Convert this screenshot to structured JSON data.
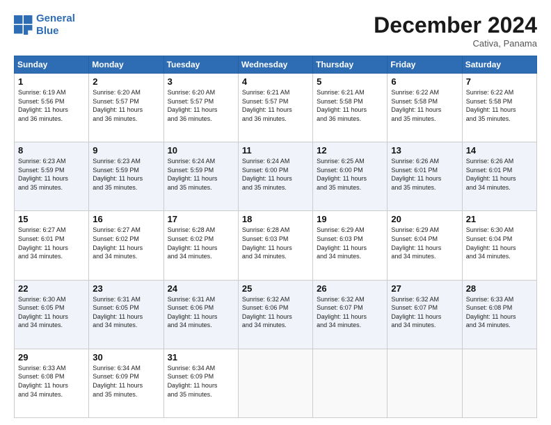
{
  "header": {
    "logo_line1": "General",
    "logo_line2": "Blue",
    "month": "December 2024",
    "location": "Cativa, Panama"
  },
  "days_of_week": [
    "Sunday",
    "Monday",
    "Tuesday",
    "Wednesday",
    "Thursday",
    "Friday",
    "Saturday"
  ],
  "weeks": [
    [
      {
        "day": "1",
        "info": "Sunrise: 6:19 AM\nSunset: 5:56 PM\nDaylight: 11 hours\nand 36 minutes."
      },
      {
        "day": "2",
        "info": "Sunrise: 6:20 AM\nSunset: 5:57 PM\nDaylight: 11 hours\nand 36 minutes."
      },
      {
        "day": "3",
        "info": "Sunrise: 6:20 AM\nSunset: 5:57 PM\nDaylight: 11 hours\nand 36 minutes."
      },
      {
        "day": "4",
        "info": "Sunrise: 6:21 AM\nSunset: 5:57 PM\nDaylight: 11 hours\nand 36 minutes."
      },
      {
        "day": "5",
        "info": "Sunrise: 6:21 AM\nSunset: 5:58 PM\nDaylight: 11 hours\nand 36 minutes."
      },
      {
        "day": "6",
        "info": "Sunrise: 6:22 AM\nSunset: 5:58 PM\nDaylight: 11 hours\nand 35 minutes."
      },
      {
        "day": "7",
        "info": "Sunrise: 6:22 AM\nSunset: 5:58 PM\nDaylight: 11 hours\nand 35 minutes."
      }
    ],
    [
      {
        "day": "8",
        "info": "Sunrise: 6:23 AM\nSunset: 5:59 PM\nDaylight: 11 hours\nand 35 minutes."
      },
      {
        "day": "9",
        "info": "Sunrise: 6:23 AM\nSunset: 5:59 PM\nDaylight: 11 hours\nand 35 minutes."
      },
      {
        "day": "10",
        "info": "Sunrise: 6:24 AM\nSunset: 5:59 PM\nDaylight: 11 hours\nand 35 minutes."
      },
      {
        "day": "11",
        "info": "Sunrise: 6:24 AM\nSunset: 6:00 PM\nDaylight: 11 hours\nand 35 minutes."
      },
      {
        "day": "12",
        "info": "Sunrise: 6:25 AM\nSunset: 6:00 PM\nDaylight: 11 hours\nand 35 minutes."
      },
      {
        "day": "13",
        "info": "Sunrise: 6:26 AM\nSunset: 6:01 PM\nDaylight: 11 hours\nand 35 minutes."
      },
      {
        "day": "14",
        "info": "Sunrise: 6:26 AM\nSunset: 6:01 PM\nDaylight: 11 hours\nand 34 minutes."
      }
    ],
    [
      {
        "day": "15",
        "info": "Sunrise: 6:27 AM\nSunset: 6:01 PM\nDaylight: 11 hours\nand 34 minutes."
      },
      {
        "day": "16",
        "info": "Sunrise: 6:27 AM\nSunset: 6:02 PM\nDaylight: 11 hours\nand 34 minutes."
      },
      {
        "day": "17",
        "info": "Sunrise: 6:28 AM\nSunset: 6:02 PM\nDaylight: 11 hours\nand 34 minutes."
      },
      {
        "day": "18",
        "info": "Sunrise: 6:28 AM\nSunset: 6:03 PM\nDaylight: 11 hours\nand 34 minutes."
      },
      {
        "day": "19",
        "info": "Sunrise: 6:29 AM\nSunset: 6:03 PM\nDaylight: 11 hours\nand 34 minutes."
      },
      {
        "day": "20",
        "info": "Sunrise: 6:29 AM\nSunset: 6:04 PM\nDaylight: 11 hours\nand 34 minutes."
      },
      {
        "day": "21",
        "info": "Sunrise: 6:30 AM\nSunset: 6:04 PM\nDaylight: 11 hours\nand 34 minutes."
      }
    ],
    [
      {
        "day": "22",
        "info": "Sunrise: 6:30 AM\nSunset: 6:05 PM\nDaylight: 11 hours\nand 34 minutes."
      },
      {
        "day": "23",
        "info": "Sunrise: 6:31 AM\nSunset: 6:05 PM\nDaylight: 11 hours\nand 34 minutes."
      },
      {
        "day": "24",
        "info": "Sunrise: 6:31 AM\nSunset: 6:06 PM\nDaylight: 11 hours\nand 34 minutes."
      },
      {
        "day": "25",
        "info": "Sunrise: 6:32 AM\nSunset: 6:06 PM\nDaylight: 11 hours\nand 34 minutes."
      },
      {
        "day": "26",
        "info": "Sunrise: 6:32 AM\nSunset: 6:07 PM\nDaylight: 11 hours\nand 34 minutes."
      },
      {
        "day": "27",
        "info": "Sunrise: 6:32 AM\nSunset: 6:07 PM\nDaylight: 11 hours\nand 34 minutes."
      },
      {
        "day": "28",
        "info": "Sunrise: 6:33 AM\nSunset: 6:08 PM\nDaylight: 11 hours\nand 34 minutes."
      }
    ],
    [
      {
        "day": "29",
        "info": "Sunrise: 6:33 AM\nSunset: 6:08 PM\nDaylight: 11 hours\nand 34 minutes."
      },
      {
        "day": "30",
        "info": "Sunrise: 6:34 AM\nSunset: 6:09 PM\nDaylight: 11 hours\nand 35 minutes."
      },
      {
        "day": "31",
        "info": "Sunrise: 6:34 AM\nSunset: 6:09 PM\nDaylight: 11 hours\nand 35 minutes."
      },
      null,
      null,
      null,
      null
    ]
  ]
}
